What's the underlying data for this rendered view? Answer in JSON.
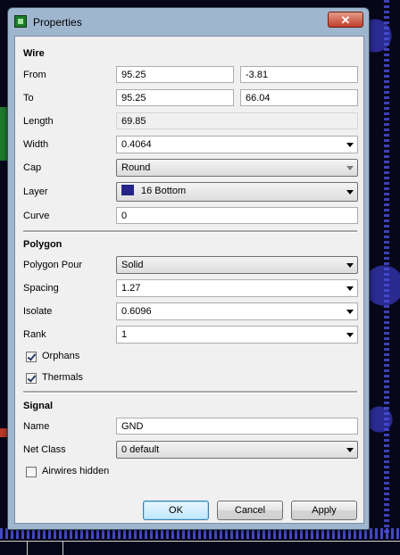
{
  "window": {
    "title": "Properties",
    "close_glyph": "✕"
  },
  "wire": {
    "section_label": "Wire",
    "from_label": "From",
    "from_x": "95.25",
    "from_y": "-3.81",
    "to_label": "To",
    "to_x": "95.25",
    "to_y": "66.04",
    "length_label": "Length",
    "length": "69.85",
    "width_label": "Width",
    "width": "0.4064",
    "cap_label": "Cap",
    "cap": "Round",
    "layer_label": "Layer",
    "layer": "16 Bottom",
    "layer_color": "#24248a",
    "curve_label": "Curve",
    "curve": "0"
  },
  "polygon": {
    "section_label": "Polygon",
    "pour_label": "Polygon Pour",
    "pour": "Solid",
    "spacing_label": "Spacing",
    "spacing": "1.27",
    "isolate_label": "Isolate",
    "isolate": "0.6096",
    "rank_label": "Rank",
    "rank": "1",
    "orphans_label": "Orphans",
    "orphans_checked": true,
    "thermals_label": "Thermals",
    "thermals_checked": true
  },
  "signal": {
    "section_label": "Signal",
    "name_label": "Name",
    "name": "GND",
    "netclass_label": "Net Class",
    "netclass": "0 default",
    "airwires_label": "Airwires hidden",
    "airwires_checked": false
  },
  "buttons": {
    "ok": "OK",
    "cancel": "Cancel",
    "apply": "Apply"
  }
}
